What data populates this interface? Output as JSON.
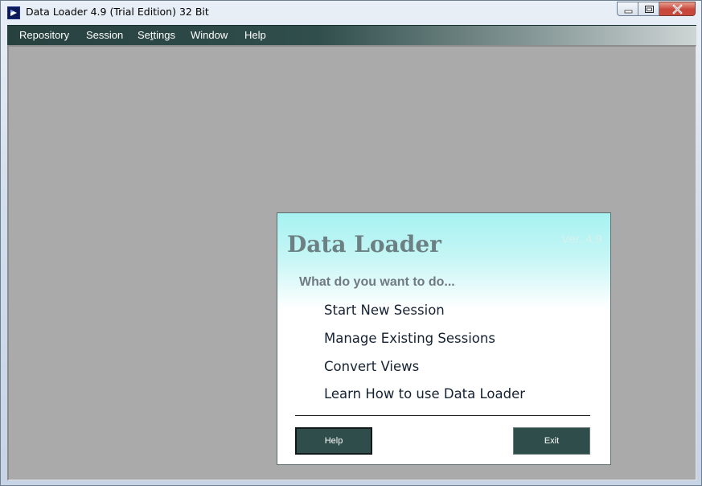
{
  "window": {
    "title": "Data Loader 4.9 (Trial Edition) 32 Bit",
    "controls": [
      "minimize-icon",
      "maximize-icon",
      "close-icon"
    ]
  },
  "menu": {
    "items": [
      {
        "label": "Repository"
      },
      {
        "label": "Session"
      },
      {
        "label": "Settings",
        "mnemonic": "t"
      },
      {
        "label": "Window"
      },
      {
        "label": "Help"
      }
    ]
  },
  "launcher": {
    "title": "Data Loader",
    "version": "Ver. 4.9",
    "prompt": "What do you want to do...",
    "options": [
      {
        "label": "Start New Session"
      },
      {
        "label": "Manage Existing Sessions"
      },
      {
        "label": "Convert Views"
      },
      {
        "label": "Learn How to use Data Loader"
      }
    ],
    "help_label": "Help",
    "exit_label": "Exit"
  },
  "colors": {
    "menubar": "#27413f",
    "workspace": "#aaaaaa",
    "button": "#2f4e4b",
    "title_text": "#6c7f82"
  }
}
